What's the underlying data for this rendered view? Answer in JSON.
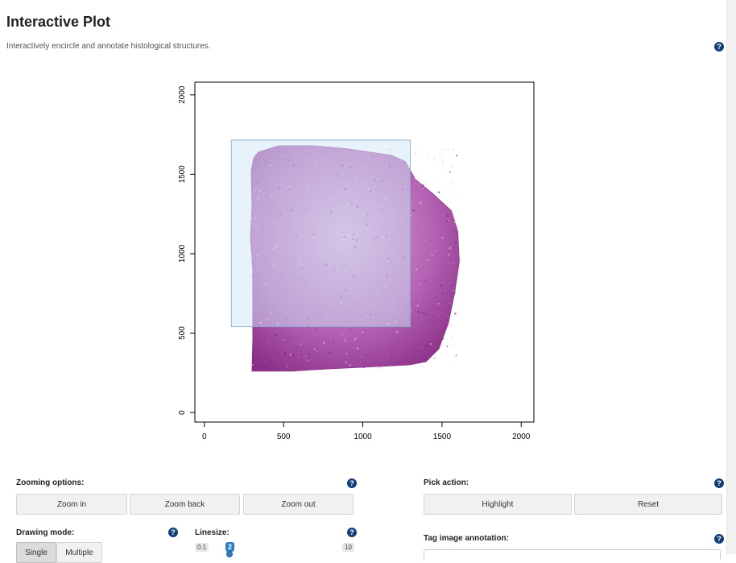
{
  "header": {
    "title": "Interactive Plot",
    "subtitle": "Interactively encircle and annotate histological structures."
  },
  "help_icon_glyph": "?",
  "plot": {
    "chart_data": {
      "type": "scatter",
      "title": "",
      "xlabel": "",
      "ylabel": "",
      "xlim": [
        -60,
        2080
      ],
      "ylim": [
        -60,
        2080
      ],
      "x_ticks": [
        0,
        500,
        1000,
        1500,
        2000
      ],
      "y_ticks": [
        0,
        500,
        1000,
        1500,
        2000
      ],
      "x_tick_labels": [
        "0",
        "500",
        "1000",
        "1500",
        "2000"
      ],
      "y_tick_labels": [
        "0",
        "500",
        "1000",
        "1500",
        "2000"
      ],
      "selection_rect": {
        "x0": 170,
        "x1": 1300,
        "y0": 540,
        "y1": 1715
      },
      "tissue_outline": [
        [
          300,
          260
        ],
        [
          305,
          470
        ],
        [
          305,
          900
        ],
        [
          290,
          1100
        ],
        [
          300,
          1300
        ],
        [
          295,
          1520
        ],
        [
          310,
          1600
        ],
        [
          340,
          1640
        ],
        [
          470,
          1680
        ],
        [
          690,
          1680
        ],
        [
          905,
          1660
        ],
        [
          1180,
          1620
        ],
        [
          1270,
          1580
        ],
        [
          1330,
          1470
        ],
        [
          1440,
          1380
        ],
        [
          1560,
          1270
        ],
        [
          1600,
          1140
        ],
        [
          1610,
          950
        ],
        [
          1580,
          750
        ],
        [
          1540,
          560
        ],
        [
          1480,
          400
        ],
        [
          1400,
          320
        ],
        [
          1300,
          300
        ],
        [
          1120,
          290
        ],
        [
          800,
          275
        ],
        [
          550,
          260
        ],
        [
          300,
          260
        ]
      ],
      "colors": {
        "tissue_light": "#d7a7d6",
        "tissue_mid": "#b563b4",
        "tissue_dark": "#8a2f87",
        "selection_fill": "#cfe5f7",
        "selection_stroke": "#7fa8cc"
      }
    }
  },
  "zoom": {
    "label": "Zooming options:",
    "buttons": [
      "Zoom in",
      "Zoom back",
      "Zoom out"
    ]
  },
  "pick": {
    "label": "Pick action:",
    "buttons": [
      "Highlight",
      "Reset"
    ]
  },
  "drawing": {
    "label": "Drawing mode:",
    "buttons": [
      "Single",
      "Multiple"
    ],
    "selected": "Single"
  },
  "linesize": {
    "label": "Linesize:",
    "min": "0.1",
    "max": "10",
    "value": "2",
    "value_fraction": 0.19
  },
  "tag": {
    "label": "Tag image annotation:",
    "value": ""
  }
}
